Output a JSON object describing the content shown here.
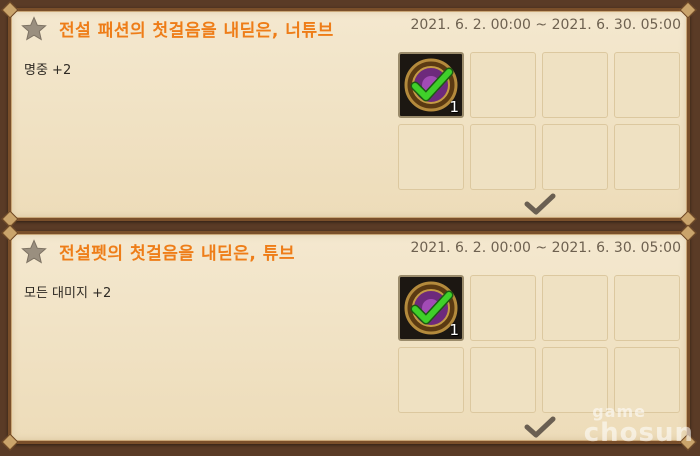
{
  "panels": [
    {
      "title": "전설 패션의 첫걸음을 내딛은, 너튜브",
      "period": "2021. 6. 2. 00:00 ~ 2021. 6. 30. 05:00",
      "effect": "명중 +2",
      "reward_item": {
        "icon": "emblem-with-green-check-icon",
        "quantity": "1"
      }
    },
    {
      "title": "전설펫의 첫걸음을 내딛은, 튜브",
      "period": "2021. 6. 2. 00:00 ~ 2021. 6. 30. 05:00",
      "effect": "모든 대미지 +2",
      "reward_item": {
        "icon": "emblem-with-green-check-icon",
        "quantity": "1"
      }
    }
  ],
  "colors": {
    "title": "#ee7d18",
    "panel_bg": "#f1e3c5",
    "frame": "#7a4f2a",
    "check_green": "#3fd02a"
  },
  "watermark": {
    "line1": "game",
    "line2": "chosun"
  }
}
